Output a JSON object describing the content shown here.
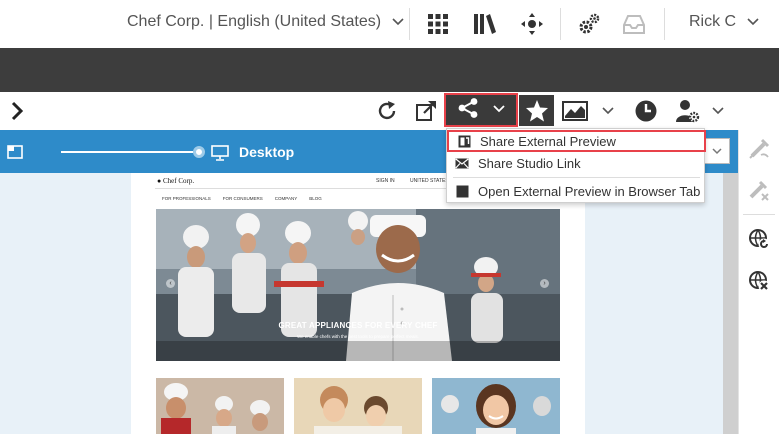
{
  "header": {
    "site_selector": "Chef Corp. | English (United States)",
    "user_name": "Rick C",
    "icons": [
      "apps-grid-icon",
      "library-icon",
      "move-icon",
      "settings-gears-icon",
      "inbox-icon"
    ]
  },
  "toolbar": {
    "icons": [
      "expand-chevron-icon",
      "reload-icon",
      "open-external-icon",
      "share-icon",
      "favorite-star-icon",
      "analytics-icon",
      "time-travel-icon",
      "user-settings-icon"
    ]
  },
  "device_bar": {
    "device_label": "Desktop",
    "slider_level": 1.0
  },
  "share_menu": {
    "items": [
      {
        "label": "Share External Preview",
        "icon": "external-preview-icon",
        "highlighted": true
      },
      {
        "label": "Share Studio Link",
        "icon": "envelope-icon",
        "highlighted": false
      },
      {
        "label": "Open External Preview in Browser Tab",
        "icon": "browser-tab-icon",
        "highlighted": false
      }
    ]
  },
  "preview": {
    "brand": "Chef Corp.",
    "sign_in": "SIGN IN",
    "region": "UNITED STATES",
    "nav": [
      "FOR PROFESSIONALS",
      "FOR CONSUMERS",
      "COMPANY",
      "BLOG"
    ],
    "hero_title": "GREAT APPLIANCES FOR EVERY CHEF",
    "hero_subtitle": "We enable chefs with the best tools to prepare perfect meals."
  },
  "side_panel": {
    "icons": [
      "edit-icon",
      "clear-edit-icon",
      "refresh-globe-icon",
      "remove-globe-icon"
    ]
  },
  "colors": {
    "device_bar": "#2e8bc9",
    "dark_band": "#3d3d3d",
    "highlight": "#e8414a",
    "canvas_bg": "#e8f1f8"
  }
}
